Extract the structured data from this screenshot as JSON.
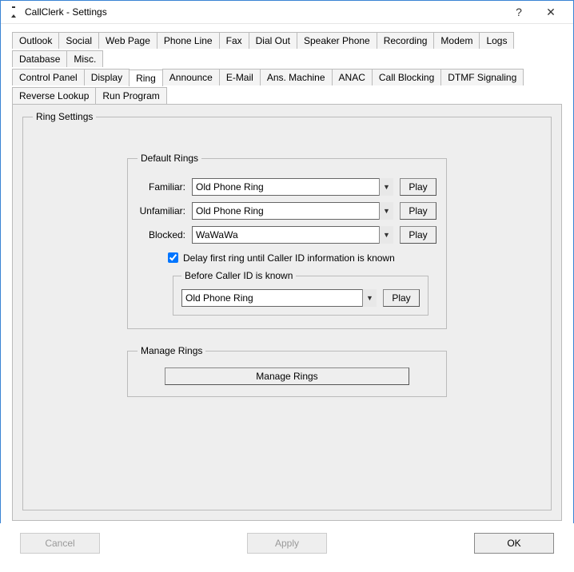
{
  "window": {
    "title": "CallClerk - Settings",
    "help_tooltip": "?",
    "close_tooltip": "✕"
  },
  "tabs_row1": [
    "Outlook",
    "Social",
    "Web Page",
    "Phone Line",
    "Fax",
    "Dial Out",
    "Speaker Phone",
    "Recording",
    "Modem",
    "Logs",
    "Database",
    "Misc."
  ],
  "tabs_row2": [
    "Control Panel",
    "Display",
    "Ring",
    "Announce",
    "E-Mail",
    "Ans. Machine",
    "ANAC",
    "Call Blocking",
    "DTMF Signaling",
    "Reverse Lookup",
    "Run Program"
  ],
  "active_tab": "Ring",
  "ring_settings": {
    "legend": "Ring Settings",
    "default_rings": {
      "legend": "Default Rings",
      "familiar_label": "Familiar:",
      "familiar_value": "Old Phone Ring",
      "unfamiliar_label": "Unfamiliar:",
      "unfamiliar_value": "Old Phone Ring",
      "blocked_label": "Blocked:",
      "blocked_value": "WaWaWa",
      "play_label": "Play",
      "delay_checked": true,
      "delay_label": "Delay first ring until Caller ID information is known",
      "before_caller_id": {
        "legend": "Before Caller ID is known",
        "value": "Old Phone Ring"
      }
    },
    "manage_rings": {
      "legend": "Manage Rings",
      "button_label": "Manage Rings"
    }
  },
  "buttons": {
    "cancel": "Cancel",
    "apply": "Apply",
    "ok": "OK"
  }
}
